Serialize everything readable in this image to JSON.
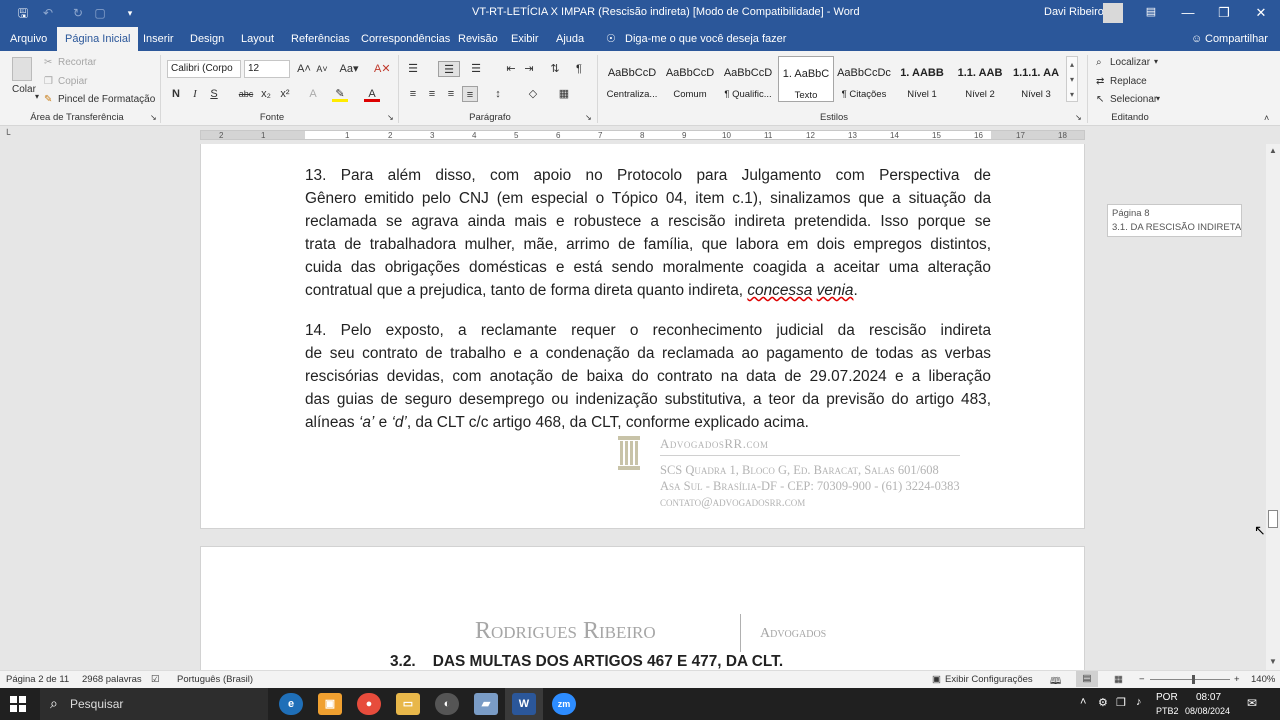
{
  "window": {
    "title": "VT-RT-LETÍCIA X IMPAR (Rescisão indireta) [Modo de Compatibilidade]  -  Word",
    "user": "Davi Ribeiro"
  },
  "tabs": [
    "Arquivo",
    "Página Inicial",
    "Inserir",
    "Design",
    "Layout",
    "Referências",
    "Correspondências",
    "Revisão",
    "Exibir",
    "Ajuda"
  ],
  "active_tab": "Página Inicial",
  "tell_me": "Diga-me o que você deseja fazer",
  "share": "Compartilhar",
  "ribbon": {
    "clipboard": {
      "paste": "Colar",
      "cut": "Recortar",
      "copy": "Copiar",
      "format_painter": "Pincel de Formatação",
      "label": "Área de Transferência"
    },
    "font": {
      "name": "Calibri (Corpo",
      "size": "12",
      "label": "Fonte",
      "bold": "N",
      "italic": "I",
      "underline": "S",
      "strike": "abc",
      "sub": "x₂",
      "sup": "x²"
    },
    "paragraph": {
      "label": "Parágrafo"
    },
    "styles": {
      "label": "Estilos",
      "items": [
        {
          "preview": "AaBbCcD",
          "name": "Centraliza..."
        },
        {
          "preview": "AaBbCcD",
          "name": "Comum"
        },
        {
          "preview": "AaBbCcD",
          "name": "¶ Qualific..."
        },
        {
          "preview": "1.  AaBbC",
          "name": "Texto"
        },
        {
          "preview": "AaBbCcDc",
          "name": "¶ Citações"
        },
        {
          "preview": "1.  AABB",
          "name": "Nível 1"
        },
        {
          "preview": "1.1.  AAB",
          "name": "Nível 2"
        },
        {
          "preview": "1.1.1.  AA",
          "name": "Nível 3"
        }
      ]
    },
    "editing": {
      "find": "Localizar",
      "replace": "Replace",
      "select": "Selecionar",
      "label": "Editando"
    }
  },
  "ruler_numbers": [
    "2",
    "1",
    "1",
    "2",
    "3",
    "4",
    "5",
    "6",
    "7",
    "8",
    "9",
    "10",
    "11",
    "12",
    "13",
    "14",
    "15",
    "16",
    "17",
    "18"
  ],
  "document": {
    "para13": {
      "lines": [
        "13.           Para além disso, com apoio no Protocolo para Julgamento com Perspectiva de",
        "Gênero emitido pelo CNJ (em especial o Tópico 04, item c.1), sinalizamos que a situação da",
        "reclamada se agrava ainda mais e robustece a rescisão indireta pretendida. Isso porque se",
        "trata de trabalhadora mulher, mãe, arrimo de família, que labora em dois empregos distintos,",
        "cuida das obrigações domésticas e está sendo moralmente coagida a aceitar uma alteração"
      ],
      "last_prefix": "contratual que a prejudica, tanto de forma direta quanto indireta, ",
      "last_italic_1": "concessa",
      "last_italic_2": "venia",
      "last_suffix": "."
    },
    "para14": {
      "lines": [
        "14.           Pelo exposto, a reclamante requer o reconhecimento judicial da rescisão indireta",
        "de seu contrato de trabalho e a condenação da reclamada ao pagamento de todas as verbas",
        "rescisórias devidas, com anotação de baixa do contrato na data de 29.07.2024 e a liberação",
        "das guias de seguro desemprego ou indenização substitutiva, a teor da previsão do artigo 483,"
      ],
      "last_a": "alíneas ",
      "last_b": "‘a’",
      "last_c": " e ",
      "last_d": "‘d’",
      "last_e": ", da CLT c/c artigo 468, da CLT, conforme explicado acima."
    },
    "footer": {
      "site": "AdvogadosRR.com",
      "address1": "SCS Quadra 1, Bloco G, Ed. Baracat, Salas 601/608",
      "address2": "Asa Sul - Brasília-DF - CEP: 70309-900 - (61) 3224-0383",
      "email": "contato@advogadosrr.com"
    },
    "header2": {
      "firm": "Rodrigues Ribeiro",
      "suffix": "Advogados"
    },
    "heading": "3.2.    DAS MULTAS DOS ARTIGOS 467 E 477, DA CLT."
  },
  "page_tooltip": {
    "page": "Página 8",
    "section": "3.1. DA RESCISÃO INDIRETA..."
  },
  "statusbar": {
    "page": "Página 2 de 11",
    "words": "2968 palavras",
    "language": "Português (Brasil)",
    "display_settings": "Exibir Configurações",
    "zoom": "140%"
  },
  "taskbar": {
    "search": "Pesquisar",
    "lang": "POR",
    "layout": "PTB2",
    "time": "08:07",
    "date": "08/08/2024"
  },
  "colors": {
    "accent": "#2b579a"
  }
}
